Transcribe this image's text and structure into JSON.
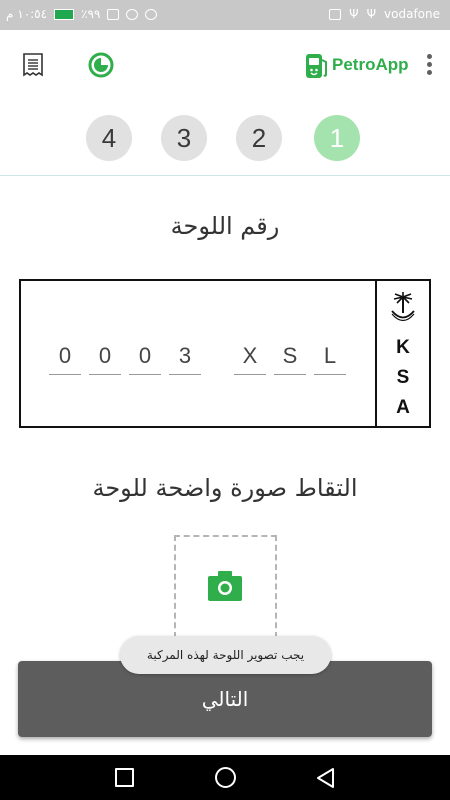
{
  "status_bar": {
    "time": "١٠:٥٤ م",
    "battery": "٪٩٩",
    "carrier": "vodafone"
  },
  "app_bar": {
    "logo_text": "PetroApp",
    "accent_color": "#2fae4b"
  },
  "steps": [
    {
      "label": "1",
      "active": true
    },
    {
      "label": "2",
      "active": false
    },
    {
      "label": "3",
      "active": false
    },
    {
      "label": "4",
      "active": false
    }
  ],
  "plate_section": {
    "title": "رقم اللوحة",
    "digits": [
      "0",
      "0",
      "0",
      "3"
    ],
    "letters": [
      "X",
      "S",
      "L"
    ],
    "country_code": [
      "K",
      "S",
      "A"
    ]
  },
  "photo_section": {
    "title": "التقاط صورة واضحة للوحة"
  },
  "toast": {
    "message": "يجب تصوير اللوحة لهذه المركبة"
  },
  "next_button": {
    "label": "التالي"
  }
}
